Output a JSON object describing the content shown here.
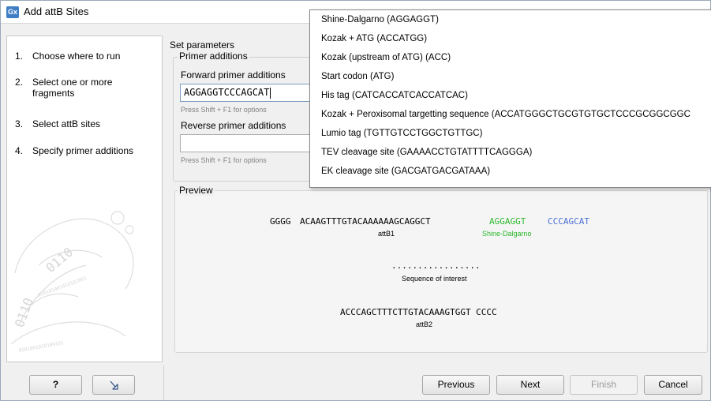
{
  "window": {
    "title": "Add attB Sites",
    "app_icon": "Gx"
  },
  "steps": [
    {
      "num": "1.",
      "label": "Choose where to run"
    },
    {
      "num": "2.",
      "label": "Select one or more fragments"
    },
    {
      "num": "3.",
      "label": "Select attB sites"
    },
    {
      "num": "4.",
      "label": "Specify primer additions"
    }
  ],
  "params": {
    "heading": "Set parameters",
    "group_title": "Primer additions",
    "forward_label": "Forward primer additions",
    "forward_value": "AGGAGGTCCCAGCAT",
    "forward_hint": "Press Shift + F1 for options",
    "reverse_label": "Reverse primer additions",
    "reverse_value": "",
    "reverse_hint": "Press Shift + F1 for options"
  },
  "preview": {
    "title": "Preview",
    "seq1_prefix": "GGGG",
    "seq1_attb": "ACAAGTTTGTACAAAAAAGCAGGCT",
    "seq1_green": "AGGAGGT",
    "seq1_blue": "CCCAGCAT",
    "label_attb1": "attB1",
    "label_shine": "Shine-Dalgarno",
    "dots": ".................",
    "label_interest": "Sequence of interest",
    "seq2": "ACCCAGCTTTCTTGTACAAAGTGGT CCCC",
    "label_attb2": "attB2",
    "colors": {
      "green": "#2db82d",
      "blue": "#4a6fd6"
    }
  },
  "dropdown": {
    "items": [
      "Shine-Dalgarno (AGGAGGT)",
      "Kozak + ATG (ACCATGG)",
      "Kozak (upstream of ATG) (ACC)",
      "Start codon (ATG)",
      "His tag (CATCACCATCACCATCAC)",
      "Kozak + Peroxisomal targetting sequence (ACCATGGGCTGCGTGTGCTCCCGCGGCGGC",
      "Lumio tag (TGTTGTCCTGGCTGTTGC)",
      "TEV cleavage site (GAAAACCTGTATTTTCAGGGA)",
      "EK cleavage site (GACGATGACGATAAA)"
    ]
  },
  "buttons": {
    "help": "?",
    "reset_icon": "undo-arrow-icon",
    "previous": "Previous",
    "next": "Next",
    "finish": "Finish",
    "cancel": "Cancel"
  }
}
